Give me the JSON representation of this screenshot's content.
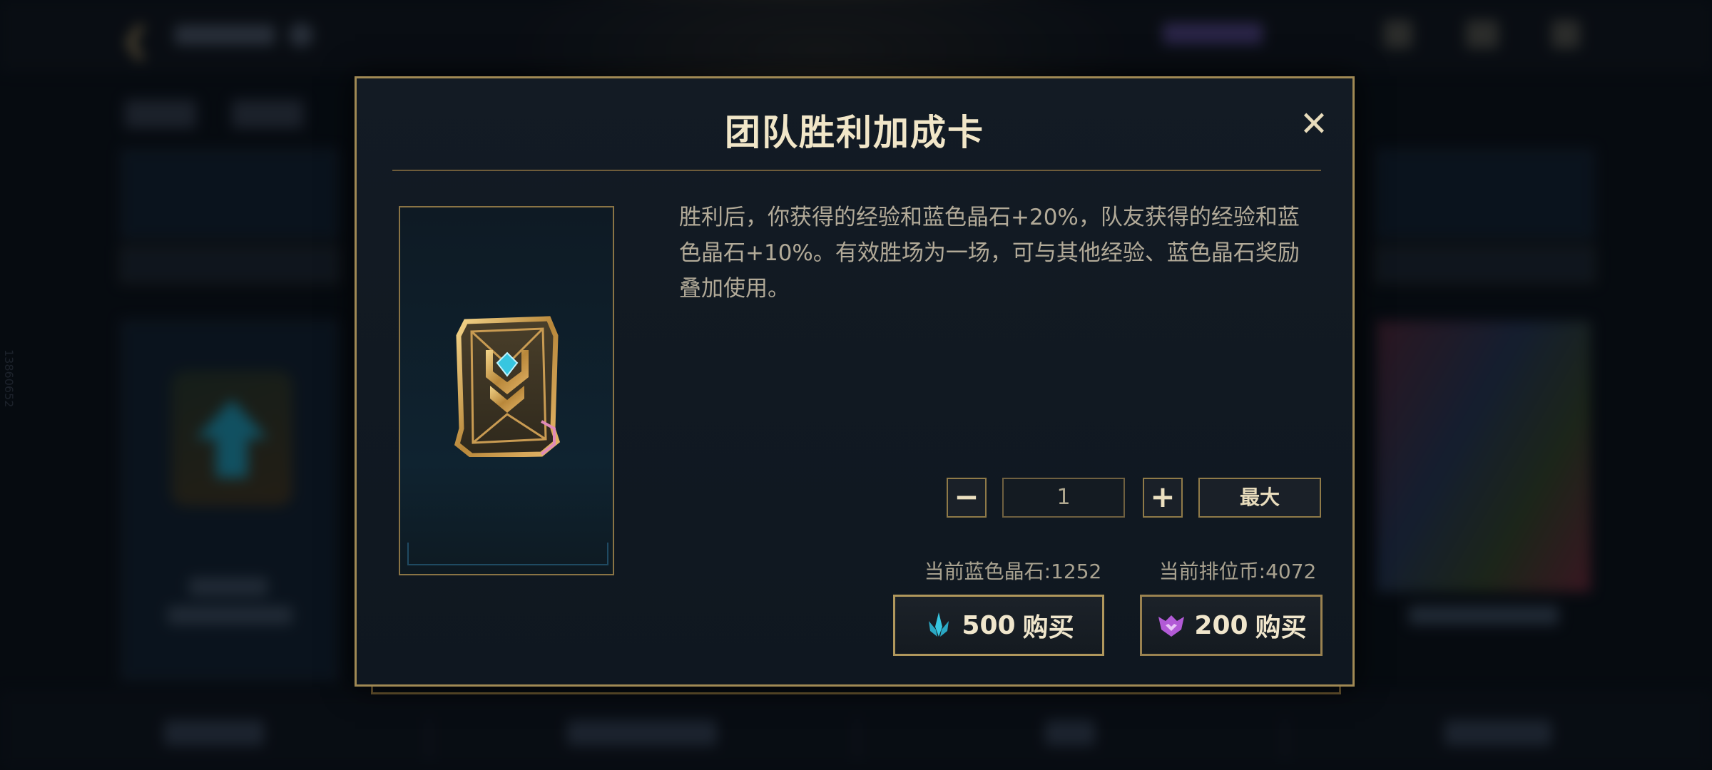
{
  "modal": {
    "title": "团队胜利加成卡",
    "close_glyph": "✕",
    "description": "胜利后，你获得的经验和蓝色晶石+20%，队友获得的经验和蓝色晶石+10%。有效胜场为一场，可与其他经验、蓝色晶石奖励叠加使用。",
    "item_icon": "team-victory-bonus-card-icon",
    "quantity": {
      "minus_label": "−",
      "value": "1",
      "plus_label": "+",
      "max_label": "最大"
    },
    "balances": {
      "blue_essence": "当前蓝色晶石:1252",
      "rank_coin": "当前排位币:4072"
    },
    "purchase": [
      {
        "currency_icon": "blue-essence-icon",
        "price": "500",
        "label": "购买",
        "color": "#37c6e0"
      },
      {
        "currency_icon": "rank-coin-icon",
        "price": "200",
        "label": "购买",
        "color": "#b25ad6"
      }
    ]
  },
  "background": {
    "side_text": "13860652"
  },
  "colors": {
    "gold_border": "#a08954",
    "title_text": "#f1e6c8",
    "panel_bg": "#131b24"
  }
}
